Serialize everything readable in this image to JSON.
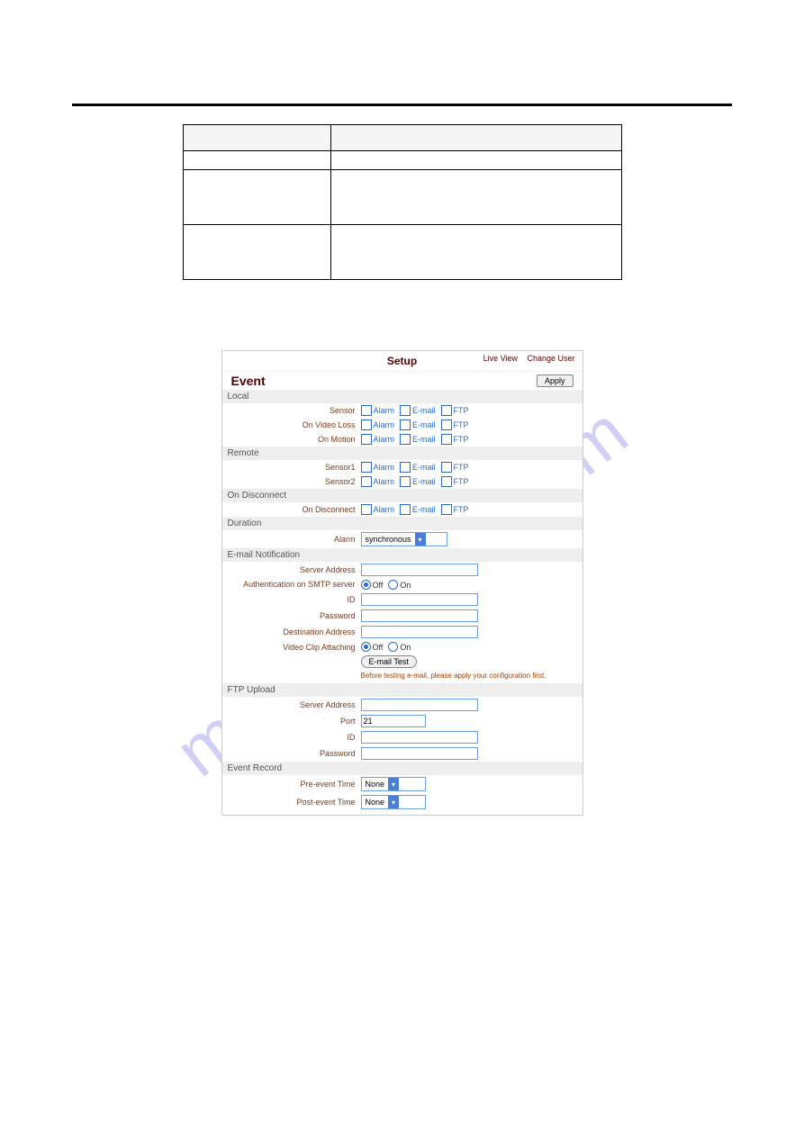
{
  "watermark": "manualslive.com",
  "defTable": {
    "r1_left": "",
    "r1_right": "",
    "r2_left": "",
    "r2_right": "",
    "r3_left": "",
    "r3_right": ""
  },
  "sectionText": "",
  "screenshot": {
    "topbar": {
      "setup": "Setup",
      "liveView": "Live View",
      "changeUser": "Change User"
    },
    "eventTitle": "Event",
    "apply": "Apply",
    "groups": {
      "local": "Local",
      "remote": "Remote",
      "onDisconnect": "On Disconnect",
      "duration": "Duration",
      "email": "E-mail Notification",
      "ftp": "FTP Upload",
      "eventRecord": "Event Record"
    },
    "labels": {
      "sensor": "Sensor",
      "onVideoLoss": "On Video Loss",
      "onMotion": "On Motion",
      "sensor1": "Sensor1",
      "sensor2": "Sensor2",
      "onDisconnect": "On Disconnect",
      "alarm": "Alarm",
      "serverAddress": "Server Address",
      "authSmtp": "Authentication on SMTP server",
      "id": "ID",
      "password": "Password",
      "destAddress": "Destination Address",
      "videoClip": "Video Clip Attaching",
      "port": "Port",
      "preEvent": "Pre-event Time",
      "postEvent": "Post-event Time"
    },
    "checks": {
      "alarm": "Alarm",
      "email": "E-mail",
      "ftp": "FTP"
    },
    "radios": {
      "off": "Off",
      "on": "On"
    },
    "selects": {
      "alarm": "synchronous",
      "preEvent": "None",
      "postEvent": "None"
    },
    "inputs": {
      "port": "21"
    },
    "emailTestBtn": "E-mail Test",
    "emailNote": "Before testing e-mail, please apply your configuration first."
  }
}
